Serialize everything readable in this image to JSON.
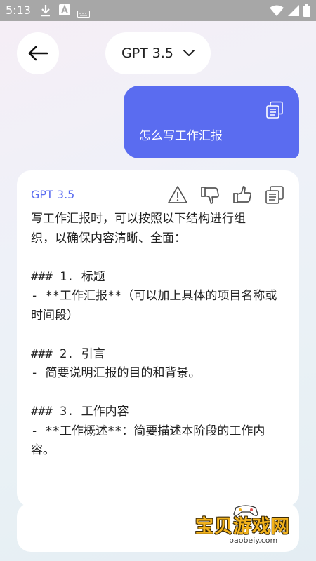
{
  "status_bar": {
    "time": "5:13"
  },
  "header": {
    "model_label": "GPT 3.5"
  },
  "user_message": {
    "text": "怎么写工作汇报"
  },
  "answer": {
    "model_label": "GPT 3.5",
    "text": "写工作汇报时，可以按照以下结构进行组\n织，以确保内容清晰、全面：\n\n### 1. 标题\n- **工作汇报**（可以加上具体的项目名称或\n时间段）\n\n### 2. 引言\n- 简要说明汇报的目的和背景。\n\n### 3. 工作内容\n- **工作概述**：简要描述本阶段的工作内\n容。"
  },
  "watermark": {
    "title": "宝贝游戏网",
    "url": "baobeiy.com"
  },
  "colors": {
    "accent": "#5a6cf0",
    "status_bar": "#a7a7a7",
    "watermark": "#f2b21c"
  }
}
